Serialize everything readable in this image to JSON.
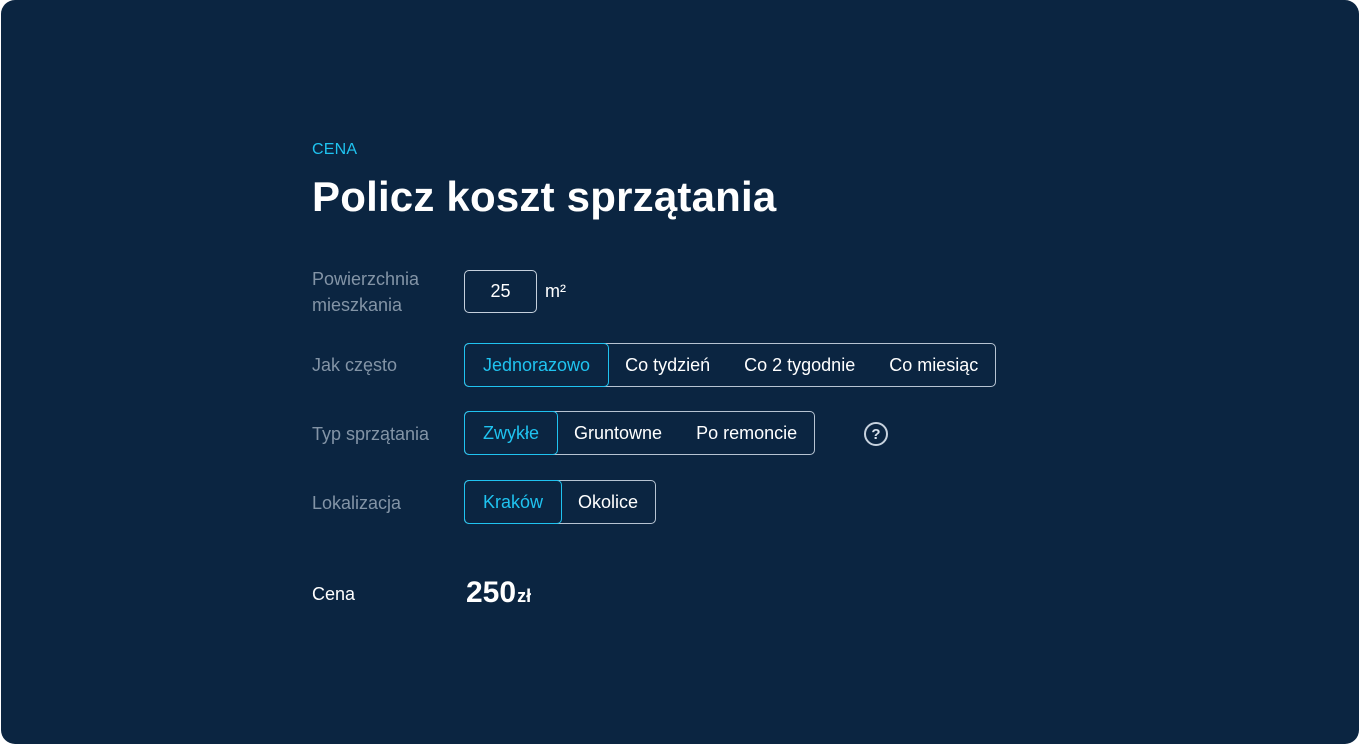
{
  "section_label": "CENA",
  "title": "Policz koszt sprzątania",
  "area": {
    "label": "Powierzchnia mieszkania",
    "value": "25",
    "unit": "m²"
  },
  "frequency": {
    "label": "Jak często",
    "options": [
      "Jednorazowo",
      "Co tydzień",
      "Co 2 tygodnie",
      "Co miesiąc"
    ],
    "selected": "Jednorazowo"
  },
  "cleaning_type": {
    "label": "Typ sprzątania",
    "options": [
      "Zwykłe",
      "Gruntowne",
      "Po remoncie"
    ],
    "selected": "Zwykłe",
    "help_icon": "question-circle-icon"
  },
  "location": {
    "label": "Lokalizacja",
    "options": [
      "Kraków",
      "Okolice"
    ],
    "selected": "Kraków"
  },
  "price": {
    "label": "Cena",
    "amount": "250",
    "currency": "zł"
  },
  "colors": {
    "background": "#0b2541",
    "accent": "#1fc3f0",
    "muted": "#8394a6"
  }
}
